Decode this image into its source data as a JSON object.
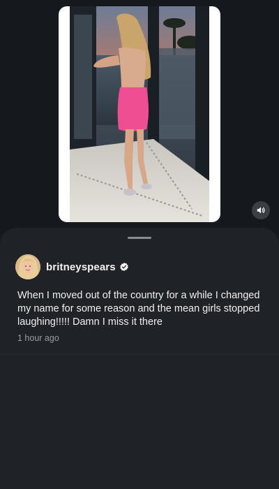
{
  "post": {
    "username": "britneyspears",
    "verified": true,
    "caption": "When I moved out of the country for a while I changed my name for some reason and the mean girls stopped laughing!!!!! Damn I miss it there",
    "timestamp": "1 hour ago"
  },
  "media": {
    "type": "video",
    "muted": false
  },
  "icons": {
    "sound": "speaker-icon",
    "verified": "verified-check-icon"
  },
  "colors": {
    "background": "#15181c",
    "sheet": "#1f2226",
    "text_primary": "#f0f0f0",
    "text_secondary": "#9a9ea3",
    "verified_badge": "#ffffff"
  }
}
